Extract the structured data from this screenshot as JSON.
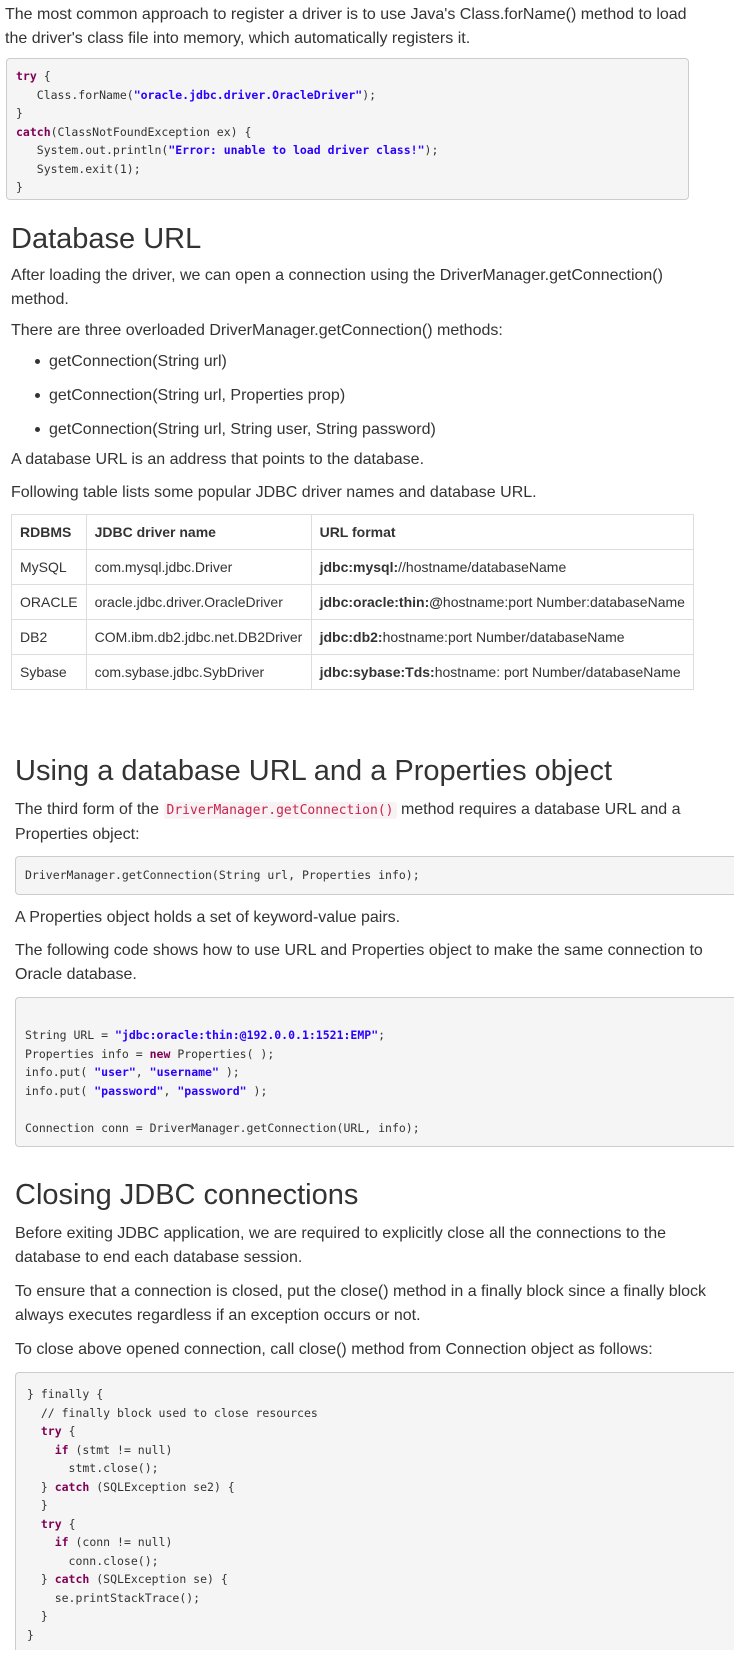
{
  "intro": {
    "para": "The most common approach to register a driver is to use Java's Class.forName() method to load the driver's class file into memory, which automatically registers it."
  },
  "code1": {
    "l1_kw": "try",
    "l1_rest": " {",
    "l2_a": "   Class.forName(",
    "l2_str": "\"oracle.jdbc.driver.OracleDriver\"",
    "l2_b": ");",
    "l3": "}",
    "l4_kw": "catch",
    "l4_rest": "(ClassNotFoundException ex) {",
    "l5_a": "   System.out.println(",
    "l5_str": "\"Error: unable to load driver class!\"",
    "l5_b": ");",
    "l6": "   System.exit(1);",
    "l7": "}"
  },
  "db_url": {
    "heading": "Database URL",
    "p1": "After loading the driver, we can open a connection using the DriverManager.getConnection() method.",
    "p2": "There are three overloaded DriverManager.getConnection() methods:",
    "items": [
      "getConnection(String url)",
      "getConnection(String url, Properties prop)",
      "getConnection(String url, String user, String password)"
    ],
    "p3": "A database URL is an address that points to the database.",
    "p4": "Following table lists some popular JDBC driver names and database URL."
  },
  "table": {
    "headers": [
      "RDBMS",
      "JDBC driver name",
      "URL format"
    ],
    "rows": [
      {
        "rdbms": "MySQL",
        "driver": "com.mysql.jdbc.Driver",
        "url_bold": "jdbc:mysql:",
        "url_rest": "//hostname/databaseName"
      },
      {
        "rdbms": "ORACLE",
        "driver": "oracle.jdbc.driver.OracleDriver",
        "url_bold": "jdbc:oracle:thin:@",
        "url_rest": "hostname:port Number:databaseName"
      },
      {
        "rdbms": "DB2",
        "driver": "COM.ibm.db2.jdbc.net.DB2Driver",
        "url_bold": "jdbc:db2:",
        "url_rest": "hostname:port Number/databaseName"
      },
      {
        "rdbms": "Sybase",
        "driver": "com.sybase.jdbc.SybDriver",
        "url_bold": "jdbc:sybase:Tds:",
        "url_rest": "hostname: port Number/databaseName"
      }
    ]
  },
  "props": {
    "heading": "Using a database URL and a Properties object",
    "p1_a": "The third form of the ",
    "p1_code": "DriverManager.getConnection()",
    "p1_b": " method requires a database URL and a Properties object:",
    "code_sig": "DriverManager.getConnection(String url, Properties info);",
    "p2": "A Properties object holds a set of keyword-value pairs.",
    "p3": "The following code shows how to use URL and Properties object to make the same connection to Oracle database."
  },
  "code2": {
    "l1_a": "String URL = ",
    "l1_str": "\"jdbc:oracle:thin:@192.0.0.1:1521:EMP\"",
    "l1_b": ";",
    "l2_a": "Properties info = ",
    "l2_kw": "new",
    "l2_b": " Properties( );",
    "l3_a": "info.put( ",
    "l3_s1": "\"user\"",
    "l3_c": ", ",
    "l3_s2": "\"username\"",
    "l3_b": " );",
    "l4_a": "info.put( ",
    "l4_s1": "\"password\"",
    "l4_c": ", ",
    "l4_s2": "\"password\"",
    "l4_b": " );",
    "l6": "Connection conn = DriverManager.getConnection(URL, info);"
  },
  "closing": {
    "heading": "Closing JDBC connections",
    "p1": "Before exiting JDBC application, we are required to explicitly close all the connections to the database to end each database session.",
    "p2": "To ensure that a connection is closed, put the close() method in a finally block since a finally block always executes regardless if an exception occurs or not.",
    "p3": "To close above opened connection, call close() method from Connection object as follows:"
  },
  "code3": {
    "l1": "} finally {",
    "l2": "  // finally block used to close resources",
    "l3_kw": "try",
    "l3_b": " {",
    "l4_kw": "if",
    "l4_b": " (stmt != null)",
    "l5": "      stmt.close();",
    "l6_a": "  } ",
    "l6_kw": "catch",
    "l6_b": " (SQLException se2) {",
    "l7": "  }",
    "l8_kw": "try",
    "l8_b": " {",
    "l9_kw": "if",
    "l9_b": " (conn != null)",
    "l10": "      conn.close();",
    "l11_a": "  } ",
    "l11_kw": "catch",
    "l11_b": " (SQLException se) {",
    "l12": "    se.printStackTrace();",
    "l13": "  }",
    "l14": "}"
  }
}
